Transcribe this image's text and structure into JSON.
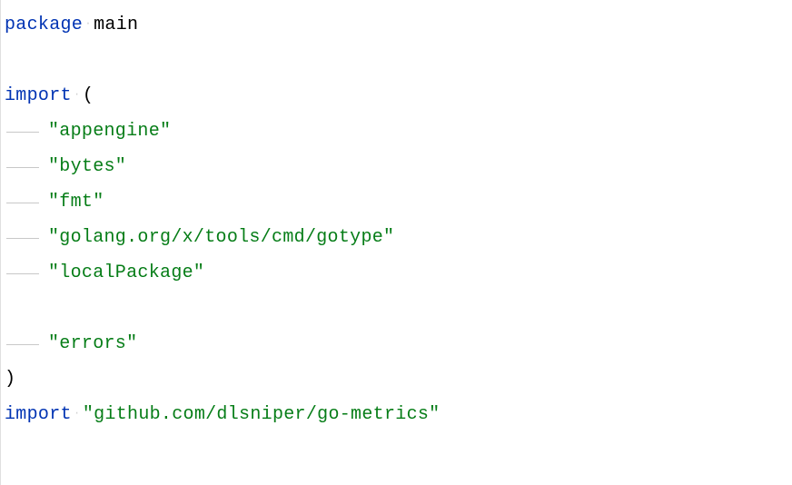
{
  "code": {
    "line1": {
      "keyword": "package",
      "pkgname": "main"
    },
    "line3": {
      "keyword": "import",
      "paren": "("
    },
    "imports": [
      "\"appengine\"",
      "\"bytes\"",
      "\"fmt\"",
      "\"golang.org/x/tools/cmd/gotype\"",
      "\"localPackage\""
    ],
    "importAfterBlank": "\"errors\"",
    "closeParen": ")",
    "line12": {
      "keyword": "import",
      "string": "\"github.com/dlsniper/go-metrics\""
    }
  }
}
